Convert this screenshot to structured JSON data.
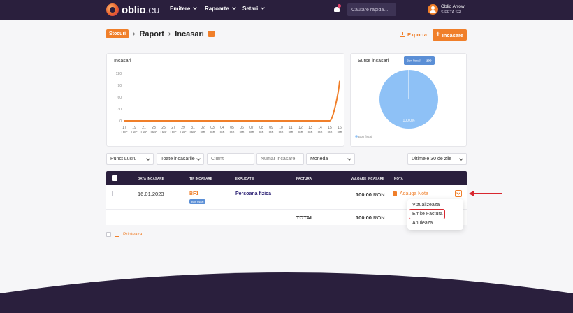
{
  "app": {
    "logo_name": "oblio",
    "logo_tld": ".eu"
  },
  "nav": [
    {
      "label": "Emitere"
    },
    {
      "label": "Rapoarte"
    },
    {
      "label": "Setari"
    }
  ],
  "search": {
    "placeholder": "Cautare rapida..."
  },
  "user": {
    "name": "Oblio Arrow",
    "company": "SIPETA SRL"
  },
  "header": {
    "tag": "Stocuri",
    "crumb1": "Raport",
    "crumb2": "Incasari",
    "export_label": "Exporta",
    "add_label": "Incasare"
  },
  "colors": {
    "accent": "#f07f2a",
    "navy": "#2a1f3d",
    "pie": "#8ec1f6",
    "highlight": "#d8272f"
  },
  "charts": [
    {
      "type": "line",
      "title": "Incasari",
      "ylim": [
        0,
        120
      ],
      "yticks": [
        0,
        30,
        60,
        90,
        120
      ],
      "categories": [
        "17 Dec",
        "19 Dec",
        "21 Dec",
        "23 Dec",
        "25 Dec",
        "27 Dec",
        "29 Dec",
        "31 Dec",
        "02 Ian",
        "03 Ian",
        "04 Ian",
        "05 Ian",
        "06 Ian",
        "07 Ian",
        "08 Ian",
        "09 Ian",
        "10 Ian",
        "11 Ian",
        "12 Ian",
        "13 Ian",
        "14 Ian",
        "15 Ian",
        "16 Ian"
      ],
      "tick_days": [
        "17",
        "19",
        "21",
        "23",
        "25",
        "27",
        "29",
        "31",
        "02",
        "03",
        "04",
        "05",
        "06",
        "07",
        "08",
        "09",
        "10",
        "11",
        "12",
        "13",
        "14",
        "15",
        "16"
      ],
      "tick_months": [
        "Dec",
        "Dec",
        "Dec",
        "Dec",
        "Dec",
        "Dec",
        "Dec",
        "Dec",
        "Ian",
        "Ian",
        "Ian",
        "Ian",
        "Ian",
        "Ian",
        "Ian",
        "Ian",
        "Ian",
        "Ian",
        "Ian",
        "Ian",
        "Ian",
        "Ian",
        "Ian"
      ],
      "values": [
        0,
        0,
        0,
        0,
        0,
        0,
        0,
        0,
        0,
        0,
        0,
        0,
        0,
        0,
        0,
        0,
        0,
        0,
        0,
        0,
        0,
        0,
        100
      ],
      "series_color": "#f07f2a"
    },
    {
      "type": "pie",
      "title": "Surse incasari",
      "slices": [
        {
          "label": "Bon fiscal",
          "value": 100,
          "pct_label": "100.0%"
        }
      ],
      "tooltip_label": "Bon fiscal",
      "tooltip_value": "100",
      "legend": "Bon fiscal",
      "legend_position": "bottom-left"
    }
  ],
  "filters": {
    "punct_lucru": "Punct Lucru",
    "tip_incasari": "Toate incasarile",
    "client_placeholder": "Client",
    "numar_placeholder": "Numar incasare",
    "moneda": "Moneda",
    "perioada": "Ultimele 30 de zile"
  },
  "table": {
    "columns": [
      "DATA INCASARE",
      "TIP INCASARE",
      "EXPLICATIE",
      "FACTURA",
      "VALOARE INCASARE",
      "NOTA"
    ],
    "row": {
      "date": "16.01.2023",
      "tip": "BF1",
      "tip_badge": "Bon fiscal",
      "explicatie": "Persoana fizica",
      "factura": "",
      "valoare": "100.00",
      "moneda": "RON",
      "nota": "Adauga Nota"
    },
    "total_label": "TOTAL",
    "total_value": "100.00",
    "total_currency": "RON"
  },
  "row_menu": [
    {
      "label": "Vizualizeaza"
    },
    {
      "label": "Emite Factura"
    },
    {
      "label": "Anuleaza"
    }
  ],
  "print_label": "Printeaza"
}
